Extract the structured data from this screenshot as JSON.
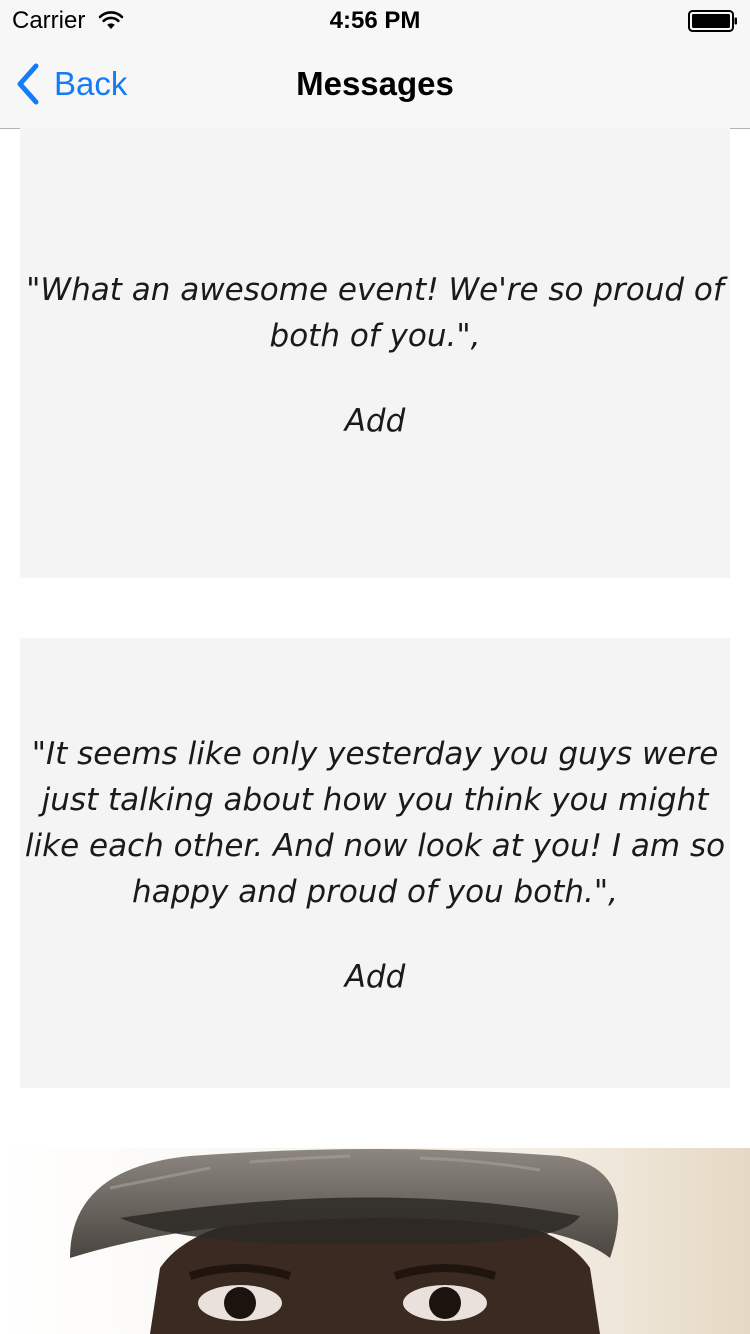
{
  "status_bar": {
    "carrier": "Carrier",
    "time": "4:56 PM",
    "wifi_icon": "wifi-icon",
    "battery_icon": "battery-icon"
  },
  "nav": {
    "back_label": "Back",
    "title": "Messages",
    "accent_color": "#137cf6"
  },
  "messages": [
    {
      "text": "\"What an awesome event! We're so proud of both of you.\",",
      "action_label": "Add"
    },
    {
      "text": "\"It seems like only yesterday you guys were just talking about how you think you might like each other.  And now look at you! I am so happy and proud of you both.\",",
      "action_label": "Add"
    }
  ],
  "photo": {
    "subject": "person-photo"
  }
}
